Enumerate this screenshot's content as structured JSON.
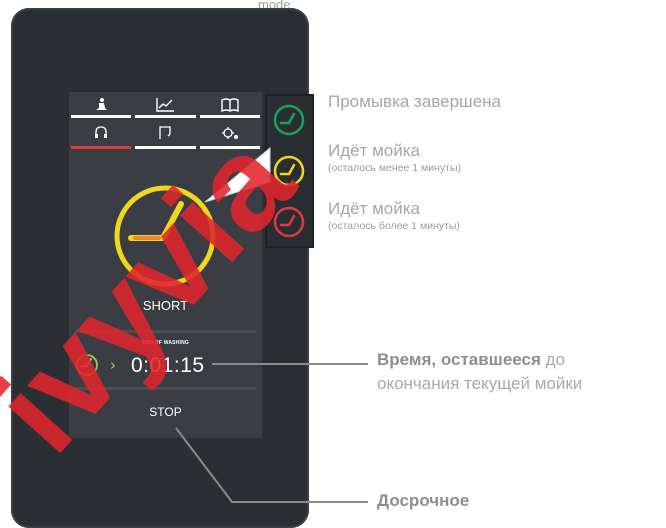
{
  "top_caption": "mode",
  "tabs_row1": [
    {
      "icon": "person-icon"
    },
    {
      "icon": "chart-icon"
    },
    {
      "icon": "book-icon"
    }
  ],
  "tabs_row2": [
    {
      "icon": "headset-icon",
      "active": true
    },
    {
      "icon": "filter-icon"
    },
    {
      "icon": "gears-icon"
    }
  ],
  "mode_label": "SHORT",
  "end_of_washing_label": "END OF WASHING",
  "timer": "0:01:15",
  "stop_label": "STOP",
  "status_legend": [
    {
      "main": "Промывка завершена",
      "sub": "",
      "color": "#1fa05a"
    },
    {
      "main": "Идёт  мойка",
      "sub": "(осталось менее 1 минуты)",
      "color": "#f2d61c"
    },
    {
      "main": "Идёт  мойка",
      "sub": "(осталось более 1 минуты)",
      "color": "#e03a3e"
    }
  ],
  "remaining_note": {
    "bold": "Время, оставшееся",
    "rest": " до",
    "line2": "окончания текущей мойки"
  },
  "early_note": {
    "bold": "Досрочное"
  },
  "watermark_text": "ivyvia",
  "colors": {
    "accent_red": "#e03a3e",
    "yellow": "#f2d61c",
    "green": "#1fa05a",
    "device": "#2b2f34"
  }
}
